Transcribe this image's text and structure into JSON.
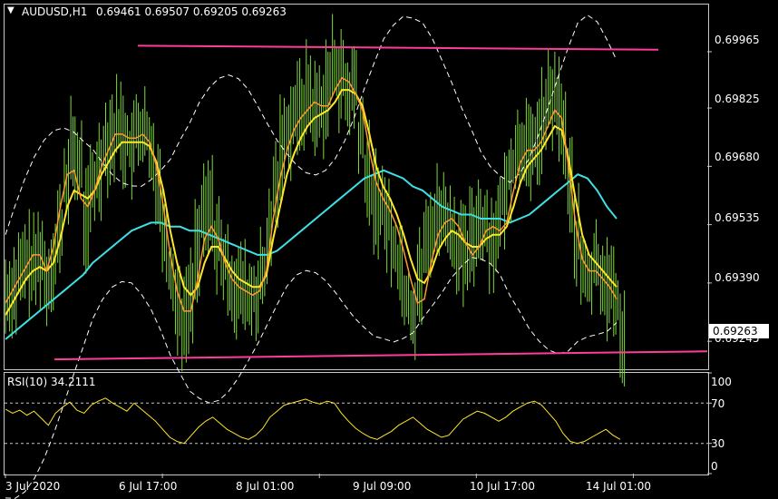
{
  "header": {
    "symbol": "AUDUSD,H1",
    "ohlc": "0.69461 0.69507 0.69205 0.69263",
    "menu_icon": "triangle-down-icon"
  },
  "rsi_header": "RSI(10) 34.2111",
  "price_axis": [
    "0.69965",
    "0.69825",
    "0.69680",
    "0.69535",
    "0.69390",
    "0.69245"
  ],
  "rsi_axis": [
    "100",
    "70",
    "30",
    "0"
  ],
  "time_axis": [
    "3 Jul 2020",
    "6 Jul 17:00",
    "8 Jul 01:00",
    "9 Jul 09:00",
    "10 Jul 17:00",
    "14 Jul 01:00"
  ],
  "current_price": "0.69263",
  "colors": {
    "candles": "#7fdb3a",
    "ma_fast": "#ff9a2e",
    "ma_mid": "#ffe628",
    "ma_slow": "#3ee0e6",
    "bands": "#ffffff",
    "trendlines": "#ff3c9a",
    "rsi": "#ffe628"
  },
  "chart_data": [
    {
      "type": "line",
      "title": "AUDUSD,H1",
      "ylim": [
        0.6918,
        0.7008
      ],
      "y_ticks": [
        0.69965,
        0.69825,
        0.6968,
        0.69535,
        0.6939,
        0.69245
      ],
      "x_ticks": [
        "3 Jul 2020",
        "6 Jul 17:00",
        "8 Jul 01:00",
        "9 Jul 09:00",
        "10 Jul 17:00",
        "14 Jul 01:00"
      ],
      "x_index_range": [
        0,
        132
      ],
      "x_tick_index": [
        0,
        24,
        48,
        72,
        96,
        120
      ],
      "series": [
        {
          "kind": "price",
          "values": [
            0.6936,
            0.6938,
            0.6941,
            0.6944,
            0.6943,
            0.6946,
            0.694,
            0.6945,
            0.6952,
            0.6964,
            0.6972,
            0.6968,
            0.6955,
            0.6962,
            0.6968,
            0.6974,
            0.6976,
            0.6978,
            0.6975,
            0.6972,
            0.6977,
            0.6976,
            0.697,
            0.6965,
            0.6952,
            0.6942,
            0.6934,
            0.693,
            0.6935,
            0.6948,
            0.6955,
            0.6958,
            0.695,
            0.6944,
            0.694,
            0.6938,
            0.6937,
            0.6935,
            0.6936,
            0.694,
            0.695,
            0.6963,
            0.6973,
            0.6978,
            0.6981,
            0.6983,
            0.6986,
            0.6982,
            0.6983,
            0.6988,
            0.6993,
            0.699,
            0.6985,
            0.6988,
            0.6975,
            0.6966,
            0.696,
            0.6958,
            0.6955,
            0.6949,
            0.6944,
            0.6936,
            0.6932,
            0.694,
            0.6948,
            0.6953,
            0.6957,
            0.6955,
            0.6952,
            0.6948,
            0.6945,
            0.695,
            0.6955,
            0.6953,
            0.695,
            0.6953,
            0.696,
            0.6968,
            0.6972,
            0.6974,
            0.697,
            0.6975,
            0.6979,
            0.6985,
            0.6983,
            0.6977,
            0.6963,
            0.695,
            0.6942,
            0.694,
            0.6944,
            0.6941,
            0.6938,
            0.6935,
            0.6926
          ]
        },
        {
          "kind": "ma_fast",
          "values": [
            0.6934,
            0.6937,
            0.694,
            0.6943,
            0.6946,
            0.6946,
            0.6942,
            0.6948,
            0.6958,
            0.6966,
            0.6967,
            0.696,
            0.6958,
            0.6962,
            0.6968,
            0.6972,
            0.6976,
            0.6976,
            0.6975,
            0.6975,
            0.6976,
            0.6974,
            0.6968,
            0.6958,
            0.6946,
            0.6937,
            0.6932,
            0.6932,
            0.694,
            0.695,
            0.6953,
            0.695,
            0.6944,
            0.694,
            0.6938,
            0.6937,
            0.6936,
            0.6937,
            0.6942,
            0.6955,
            0.6965,
            0.6972,
            0.6977,
            0.698,
            0.6982,
            0.6984,
            0.6983,
            0.6983,
            0.6987,
            0.699,
            0.6989,
            0.6986,
            0.6982,
            0.6972,
            0.6964,
            0.696,
            0.6957,
            0.6953,
            0.6947,
            0.694,
            0.6934,
            0.6935,
            0.6944,
            0.6951,
            0.6954,
            0.6955,
            0.6953,
            0.6949,
            0.6946,
            0.6948,
            0.6952,
            0.6953,
            0.6952,
            0.6954,
            0.6962,
            0.6969,
            0.6972,
            0.6972,
            0.6974,
            0.6978,
            0.6982,
            0.698,
            0.6968,
            0.6954,
            0.6945,
            0.6942,
            0.6942,
            0.694,
            0.6938,
            0.6935
          ]
        },
        {
          "kind": "ma_mid",
          "values": [
            0.6931,
            0.6934,
            0.6937,
            0.694,
            0.6942,
            0.6943,
            0.6942,
            0.6944,
            0.695,
            0.6958,
            0.6962,
            0.6961,
            0.696,
            0.6962,
            0.6966,
            0.6969,
            0.6972,
            0.6974,
            0.6974,
            0.6974,
            0.6974,
            0.6973,
            0.6969,
            0.6962,
            0.6952,
            0.6944,
            0.6938,
            0.6936,
            0.6938,
            0.6944,
            0.6948,
            0.6948,
            0.6945,
            0.6942,
            0.694,
            0.6939,
            0.6938,
            0.6938,
            0.6941,
            0.695,
            0.6958,
            0.6966,
            0.6971,
            0.6975,
            0.6978,
            0.698,
            0.6981,
            0.6982,
            0.6984,
            0.6987,
            0.6987,
            0.6986,
            0.6983,
            0.6976,
            0.6968,
            0.6963,
            0.696,
            0.6956,
            0.6951,
            0.6945,
            0.694,
            0.6939,
            0.6942,
            0.6947,
            0.695,
            0.6952,
            0.6951,
            0.6949,
            0.6948,
            0.6948,
            0.695,
            0.6951,
            0.6951,
            0.6953,
            0.6958,
            0.6964,
            0.6968,
            0.697,
            0.6972,
            0.6975,
            0.6978,
            0.6977,
            0.697,
            0.696,
            0.6951,
            0.6946,
            0.6944,
            0.6942,
            0.694,
            0.6938
          ]
        },
        {
          "kind": "ma_slow",
          "values": [
            0.6925,
            0.6927,
            0.6929,
            0.6931,
            0.6933,
            0.6935,
            0.6937,
            0.6939,
            0.6941,
            0.6944,
            0.6946,
            0.6948,
            0.695,
            0.6952,
            0.6953,
            0.6954,
            0.6954,
            0.6953,
            0.6953,
            0.6952,
            0.6952,
            0.6951,
            0.695,
            0.6949,
            0.6948,
            0.6947,
            0.6946,
            0.6946,
            0.6947,
            0.6949,
            0.6951,
            0.6953,
            0.6955,
            0.6957,
            0.6959,
            0.6961,
            0.6963,
            0.6965,
            0.6966,
            0.6967,
            0.6966,
            0.6965,
            0.6963,
            0.6962,
            0.696,
            0.6958,
            0.6957,
            0.6956,
            0.6956,
            0.6955,
            0.6955,
            0.6955,
            0.6954,
            0.6955,
            0.6956,
            0.6958,
            0.696,
            0.6962,
            0.6964,
            0.6966,
            0.6965,
            0.6962,
            0.6958,
            0.6955
          ]
        },
        {
          "kind": "trendline_upper",
          "values": [
            0.6998,
            0.6997
          ]
        },
        {
          "kind": "trendline_lower",
          "values": [
            0.692,
            0.6922
          ]
        }
      ]
    },
    {
      "type": "line",
      "title": "RSI(10) 34.2111",
      "ylim": [
        0,
        100
      ],
      "y_ticks": [
        100,
        70,
        30,
        0
      ],
      "series": [
        {
          "name": "RSI(10)",
          "values": [
            64,
            60,
            63,
            58,
            62,
            55,
            48,
            60,
            66,
            71,
            63,
            60,
            68,
            72,
            75,
            70,
            66,
            62,
            70,
            64,
            58,
            52,
            44,
            36,
            32,
            30,
            38,
            46,
            52,
            56,
            50,
            44,
            40,
            36,
            34,
            38,
            45,
            56,
            62,
            68,
            70,
            72,
            74,
            71,
            69,
            72,
            70,
            60,
            52,
            45,
            40,
            36,
            34,
            38,
            42,
            48,
            52,
            56,
            50,
            44,
            40,
            36,
            38,
            46,
            54,
            58,
            62,
            60,
            56,
            52,
            56,
            62,
            66,
            70,
            72,
            68,
            60,
            52,
            40,
            32,
            30,
            32,
            36,
            40,
            44,
            38,
            34
          ]
        }
      ]
    }
  ]
}
